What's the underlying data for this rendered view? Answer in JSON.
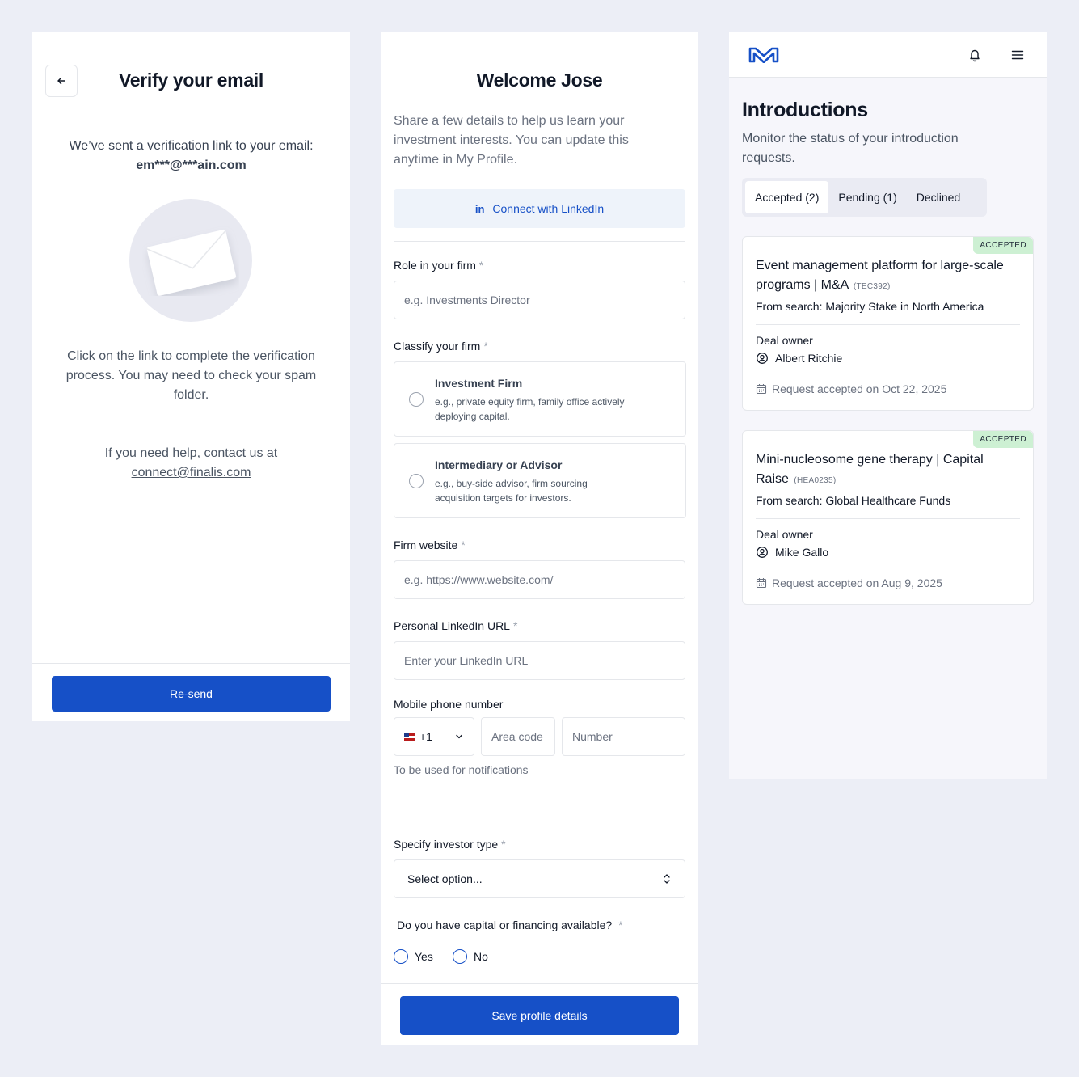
{
  "verify": {
    "title": "Verify your email",
    "sent_text": "We’ve sent a verification link to your email:",
    "email": "em***@***ain.com",
    "click_text": "Click on the link to complete the verification process. You may need to check your spam folder.",
    "help_text": "If you need help, contact us at",
    "help_email": "connect@finalis.com",
    "resend_label": "Re-send"
  },
  "welcome": {
    "title": "Welcome Jose",
    "intro": "Share a few details to help us learn your investment interests. You can update this anytime in My Profile.",
    "linkedin_icon": "in",
    "linkedin_label": "Connect with LinkedIn",
    "role_label": "Role in your firm",
    "role_placeholder": "e.g. Investments Director",
    "classify_label": "Classify your firm",
    "firm_options": [
      {
        "title": "Investment Firm",
        "desc": "e.g., private equity firm, family office actively deploying capital."
      },
      {
        "title": "Intermediary or Advisor",
        "desc": "e.g., buy-side advisor, firm sourcing acquisition targets for investors."
      }
    ],
    "website_label": "Firm website",
    "website_placeholder": "e.g. https://www.website.com/",
    "linkedin_url_label": "Personal LinkedIn URL",
    "linkedin_url_placeholder": "Enter your LinkedIn URL",
    "phone_label": "Mobile phone number",
    "country_code": "+1",
    "area_placeholder": "Area code",
    "number_placeholder": "Number",
    "phone_hint": "To be used for notifications",
    "investor_type_label": "Specify investor type",
    "investor_type_value": "Select option...",
    "capital_label": "Do you have capital or financing available?",
    "yes_label": "Yes",
    "no_label": "No",
    "required_mark": "*",
    "save_label": "Save profile details"
  },
  "introductions": {
    "title": "Introductions",
    "subtitle": "Monitor the status of your introduction requests.",
    "tabs": [
      {
        "label": "Accepted (2)",
        "active": true
      },
      {
        "label": "Pending (1)",
        "active": false
      },
      {
        "label": "Declined",
        "active": false
      }
    ],
    "cards": [
      {
        "badge": "ACCEPTED",
        "title": "Event management platform for large-scale programs | M&A",
        "code": "(TEC392)",
        "from": "From search: Majority Stake in North America",
        "owner_label": "Deal owner",
        "owner": "Albert Ritchie",
        "date": "Request accepted on Oct 22, 2025"
      },
      {
        "badge": "ACCEPTED",
        "title": "Mini-nucleosome gene therapy | Capital Raise",
        "code": "(HEA0235)",
        "from": "From search: Global Healthcare Funds",
        "owner_label": "Deal owner",
        "owner": "Mike Gallo",
        "date": "Request accepted on Aug 9, 2025"
      }
    ]
  },
  "colors": {
    "accent": "#1650c7",
    "badge_bg": "#cdf0d3",
    "background": "#eceef6"
  },
  "icons": [
    "arrow-left-icon",
    "envelope-icon",
    "linkedin-icon",
    "flag-icon",
    "chevron-down-icon",
    "updown-icon",
    "logo-icon",
    "bell-icon",
    "menu-icon",
    "user-circle-icon",
    "calendar-icon"
  ]
}
